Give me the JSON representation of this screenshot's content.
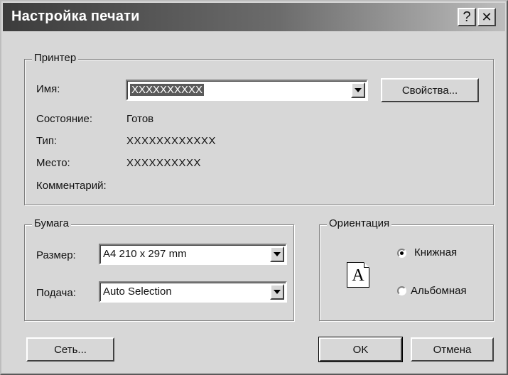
{
  "window": {
    "title": "Настройка печати",
    "help_glyph": "?",
    "close_glyph": "✕"
  },
  "printer": {
    "legend": "Принтер",
    "name_label": "Имя:",
    "name_value": "XXXXXXXXXX",
    "properties_button": "Свойства...",
    "status_label": "Состояние:",
    "status_value": "Готов",
    "type_label": "Тип:",
    "type_value": "XXXXXXXXXXXX",
    "location_label": "Место:",
    "location_value": "XXXXXXXXXX",
    "comment_label": "Комментарий:",
    "comment_value": ""
  },
  "paper": {
    "legend": "Бумага",
    "size_label": "Размер:",
    "size_value": "A4 210 x 297 mm",
    "source_label": "Подача:",
    "source_value": "Auto Selection"
  },
  "orientation": {
    "legend": "Ориентация",
    "page_glyph": "A",
    "portrait_label": "Книжная",
    "landscape_label": "Альбомная",
    "selected": "portrait"
  },
  "buttons": {
    "network": "Сеть...",
    "ok": "OK",
    "cancel": "Отмена"
  },
  "icons": {
    "dropdown": "chevron-down-icon",
    "help": "help-icon",
    "close": "close-icon",
    "orientation": "page-portrait-icon"
  }
}
